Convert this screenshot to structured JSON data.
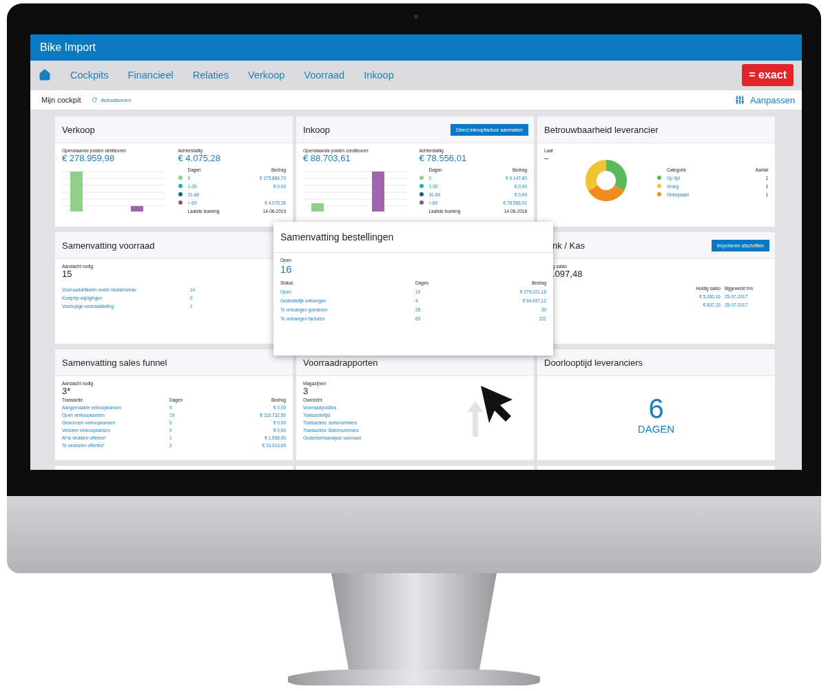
{
  "app": {
    "title": "Bike Import"
  },
  "nav": {
    "items": [
      {
        "label": "Cockpits"
      },
      {
        "label": "Financieel"
      },
      {
        "label": "Relaties"
      },
      {
        "label": "Verkoop"
      },
      {
        "label": "Voorraad"
      },
      {
        "label": "Inkoop"
      }
    ],
    "logo": "= exact"
  },
  "toolbar": {
    "title": "Mijn cockpit",
    "refresh": "Actualiseren",
    "customize": "Aanpassen"
  },
  "cards": [
    {
      "kind": "aging",
      "title": "Verkoop",
      "open_label": "Openstaande posten debiteuren",
      "open_amount": "€ 278.959,98",
      "due_label": "Achterstallig",
      "due_amount": "€ 4.075,28",
      "columns": [
        "Dagen",
        "Bedrag"
      ],
      "rows": [
        {
          "days": "0",
          "amount": "€ 275.884,70",
          "color": "#8fcf8a"
        },
        {
          "days": "1-30",
          "amount": "€ 0,00",
          "color": "#17b3b8"
        },
        {
          "days": "31-60",
          "amount": "",
          "color": "#0d5f8c"
        },
        {
          "days": "> 60",
          "amount": "€ 4.075,28",
          "color": "#8e4f96"
        }
      ],
      "last_label": "Laatste boeking",
      "last_date": "14-06-2019"
    },
    {
      "kind": "aging",
      "title": "Inkoop",
      "button": "Direct inkoopfactuur aanmaken",
      "open_label": "Openstaande posten crediteuren",
      "open_amount": "€ 88.703,61",
      "due_label": "Achterstallig",
      "due_amount": "€ 78.556,01",
      "columns": [
        "Dagen",
        "Bedrag"
      ],
      "rows": [
        {
          "days": "0",
          "amount": "€ 9.147,60",
          "color": "#8fcf8a"
        },
        {
          "days": "1-30",
          "amount": "€ 0,00",
          "color": "#17b3b8"
        },
        {
          "days": "31-60",
          "amount": "€ 0,00",
          "color": "#0d5f8c"
        },
        {
          "days": "> 60",
          "amount": "€ 78.556,01",
          "color": "#8e4f96"
        }
      ],
      "last_label": "Laatste boeking",
      "last_date": "14-06-2018"
    },
    {
      "kind": "donut",
      "title": "Betrouwbaarheid leverancier",
      "label": "Laat",
      "value": "–",
      "columns": [
        "Categorie",
        "Aantal"
      ],
      "rows": [
        {
          "label": "Op tijd",
          "count": "1",
          "color": "#5cb85c"
        },
        {
          "label": "Vroeg",
          "count": "1",
          "color": "#f0c430"
        },
        {
          "label": "Onbepaald",
          "count": "1",
          "color": "#f08c1c"
        }
      ]
    },
    {
      "kind": "list",
      "title": "Samenvatting voorraad",
      "label": "Aandacht nodig",
      "value": "15",
      "rows": [
        {
          "label": "Voorraadartikelen onder bestelniveau",
          "value": "14"
        },
        {
          "label": "Kostprijs wijzigingen",
          "value": "0"
        },
        {
          "label": "Voorlopige voorraadtelling",
          "value": "1"
        }
      ]
    },
    {
      "kind": "bank",
      "title": "nk / Kas",
      "button": "Importeren afschriften",
      "label": "g saldo",
      "value": ".097,48",
      "columns": [
        "Huidig saldo",
        "Bijgewerkt t/m"
      ],
      "rows": [
        {
          "balance": "€ 5.260,16",
          "date": "25-07-2017"
        },
        {
          "balance": "€ 837,33",
          "date": "25-07-2017"
        }
      ]
    },
    {
      "kind": "funnel",
      "title": "Samenvatting sales funnel",
      "label": "Aandacht nodig",
      "value": "3*",
      "columns": [
        "Transactie",
        "Dagen",
        "Bedrag"
      ],
      "rows": [
        {
          "label": "Aangemaakte verkoopkansen",
          "days": "0",
          "amount": "€ 0,00"
        },
        {
          "label": "Open verkoopkansen",
          "days": "19",
          "amount": "€ 116.732,50"
        },
        {
          "label": "Gewonnen verkoopkansen",
          "days": "0",
          "amount": "€ 0,00"
        },
        {
          "label": "Verloren verkoopkansen",
          "days": "0",
          "amount": "€ 0,00"
        },
        {
          "label": "Af te drukken offertes*",
          "days": "1",
          "amount": "€ 1.598,00"
        },
        {
          "label": "Te versturen offertes*",
          "days": "2",
          "amount": "€ 10.913,00"
        }
      ]
    },
    {
      "kind": "reports",
      "title": "Voorraadrapporten",
      "label": "Magazijnen",
      "value": "3",
      "sub": "Overzicht",
      "links": [
        "Voorraadposities",
        "Transactielijst",
        "Transacties: serienummers",
        "Transacties: Batchnummers",
        "Ouderdomsanalyse voorraad"
      ]
    },
    {
      "kind": "big",
      "title": "Doorlooptijd leveranciers",
      "value": "6",
      "unit": "DAGEN"
    }
  ],
  "popup": {
    "title": "Samenvatting bestellingen",
    "label": "Open",
    "value": "16",
    "columns": [
      "Status",
      "Dagen",
      "Bedrag"
    ],
    "rows": [
      {
        "label": "Open",
        "days": "19",
        "amount": "€ 279.221,18"
      },
      {
        "label": "Gedeeltelijk ontvangen",
        "days": "4",
        "amount": "€ 94.997,12"
      },
      {
        "label": "Te ontvangen goederen",
        "days": "25",
        "amount": "30"
      },
      {
        "label": "Te ontvangen facturen",
        "days": "65",
        "amount": "122"
      }
    ]
  }
}
